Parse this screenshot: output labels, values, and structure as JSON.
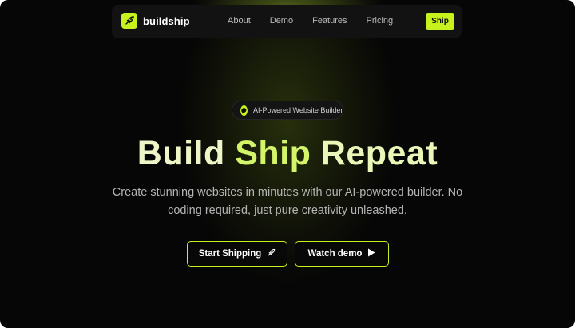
{
  "nav": {
    "brand": "buildship",
    "links": [
      "About",
      "Demo",
      "Features",
      "Pricing"
    ],
    "cta": "Ship"
  },
  "badge": {
    "text": "AI-Powered Website Builder",
    "icon": "brain-icon"
  },
  "hero": {
    "title_words": [
      "Build",
      "Ship",
      "Repeat"
    ],
    "subtitle": "Create stunning websites in minutes with our AI-powered builder. No coding required, just pure creativity unleashed."
  },
  "buttons": {
    "primary": {
      "label": "Start Shipping",
      "icon": "rocket-icon"
    },
    "secondary": {
      "label": "Watch demo",
      "icon": "play-icon"
    }
  },
  "colors": {
    "accent": "#c8f21d",
    "background": "#060606",
    "nav_bg": "#121212",
    "text_muted": "#b4b4b4"
  }
}
